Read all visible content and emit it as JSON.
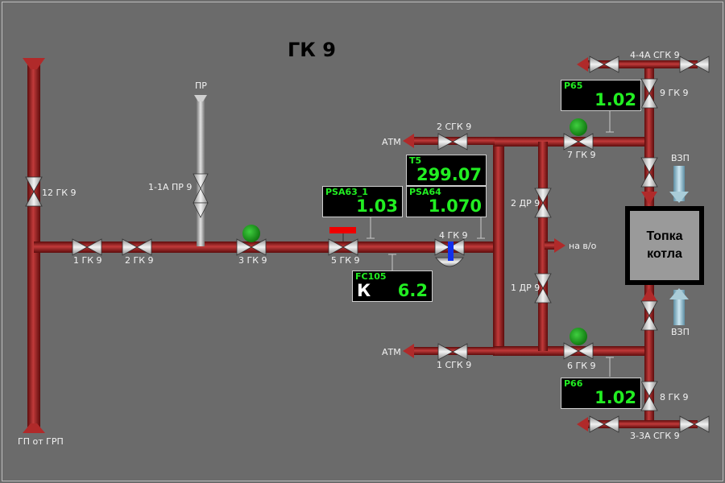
{
  "title": "ГК 9",
  "labels": {
    "v12": "12 ГК 9",
    "gp_source": "ГП от ГРП",
    "v1": "1 ГК 9",
    "v2": "2 ГК 9",
    "v3": "3 ГК 9",
    "v5": "5 ГК 9",
    "v4": "4 ГК 9",
    "pr": "ПР",
    "v1_1a": "1-1А ПР 9",
    "atm_top": "АТМ",
    "v2sgk": "2 СГК 9",
    "atm_bottom": "АТМ",
    "v1sgk": "1 СГК 9",
    "v7": "7 ГК 9",
    "v6": "6 ГК 9",
    "v2dr": "2 ДР 9",
    "v1dr": "1 ДР 9",
    "na_vo": "на в/о",
    "v4_4a": "4-4А СГК 9",
    "v9": "9 ГК 9",
    "v3_3a": "3-3А СГК 9",
    "v8": "8 ГК 9",
    "vzp_top": "ВЗП",
    "vzp_bottom": "ВЗП"
  },
  "furnace": {
    "label": "Топка\nкотла"
  },
  "panels": {
    "t5": {
      "tag": "T5",
      "value": "299.07"
    },
    "psa63": {
      "tag": "PSA63_1",
      "value": "1.03"
    },
    "psa64": {
      "tag": "PSA64",
      "value": "1.070"
    },
    "fc105": {
      "tag": "FC105",
      "mode": "К",
      "value": "6.2"
    },
    "p65": {
      "tag": "P65",
      "value": "1.02"
    },
    "p66": {
      "tag": "P66",
      "value": "1.02"
    }
  },
  "colors": {
    "background": "#6b6b6b",
    "pipe_gas": "#9c1c1c",
    "pipe_grey": "#a8a8a8",
    "pipe_blue": "#8fb8c8",
    "status_on": "#1aa01a",
    "value_text": "#22ee22",
    "alarm_bar": "#ee0000",
    "actuator": "#1030ee"
  }
}
